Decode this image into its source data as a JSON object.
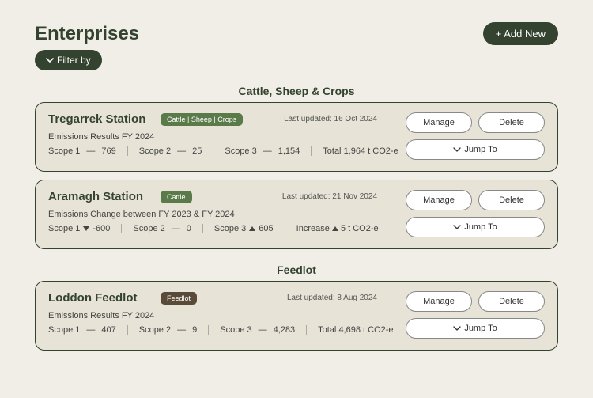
{
  "header": {
    "title": "Enterprises",
    "add_new_label": "+ Add New",
    "filter_label": "Filter by"
  },
  "sections": [
    {
      "title": "Cattle, Sheep & Crops",
      "cards": [
        {
          "name": "Tregarrek Station",
          "tag_text": "Cattle | Sheep | Crops",
          "tag_class": "tag-green",
          "last_updated": "Last updated: 16 Oct 2024",
          "results_label": "Emissions Results FY 2024",
          "scopes": [
            {
              "label": "Scope 1",
              "value": "769",
              "change": null
            },
            {
              "label": "Scope 2",
              "value": "25",
              "change": null
            },
            {
              "label": "Scope 3",
              "value": "1,154",
              "change": null
            }
          ],
          "total_label": "Total",
          "total_value": "1,964 t CO2-e",
          "total_change": null
        },
        {
          "name": "Aramagh Station",
          "tag_text": "Cattle",
          "tag_class": "tag-green",
          "last_updated": "Last updated: 21 Nov 2024",
          "results_label": "Emissions Change between FY 2023 & FY 2024",
          "scopes": [
            {
              "label": "Scope 1",
              "value": "-600",
              "change": "down"
            },
            {
              "label": "Scope 2",
              "value": "0",
              "change": null
            },
            {
              "label": "Scope 3",
              "value": "605",
              "change": "up"
            }
          ],
          "total_label": "Increase",
          "total_value": "5 t CO2-e",
          "total_change": "up"
        }
      ]
    },
    {
      "title": "Feedlot",
      "cards": [
        {
          "name": "Loddon Feedlot",
          "tag_text": "Feedlot",
          "tag_class": "tag-brown",
          "last_updated": "Last updated: 8 Aug 2024",
          "results_label": "Emissions Results FY 2024",
          "scopes": [
            {
              "label": "Scope 1",
              "value": "407",
              "change": null
            },
            {
              "label": "Scope 2",
              "value": "9",
              "change": null
            },
            {
              "label": "Scope 3",
              "value": "4,283",
              "change": null
            }
          ],
          "total_label": "Total",
          "total_value": "4,698 t CO2-e",
          "total_change": null
        }
      ]
    }
  ],
  "actions": {
    "manage": "Manage",
    "delete": "Delete",
    "jump_to": "Jump To"
  }
}
